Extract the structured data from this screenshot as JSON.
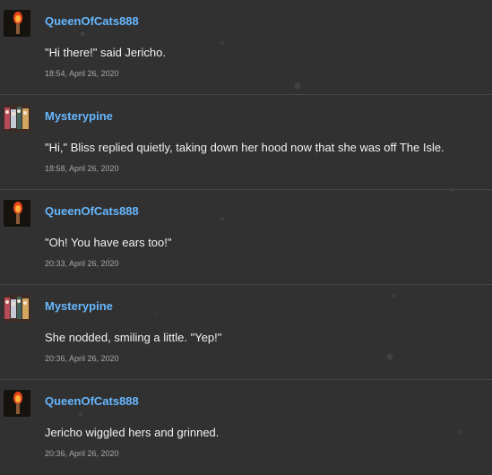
{
  "thread": {
    "posts": [
      {
        "username": "QueenOfCats888",
        "avatar_icon": "torch-flame-avatar",
        "message": "\"Hi there!\" said Jericho.",
        "timestamp": "18:54, April 26, 2020"
      },
      {
        "username": "Mysterypine",
        "avatar_icon": "colorful-group-avatar",
        "message": "\"Hi,\" Bliss replied quietly, taking down her hood now that she was off The Isle.",
        "timestamp": "18:58, April 26, 2020"
      },
      {
        "username": "QueenOfCats888",
        "avatar_icon": "torch-flame-avatar",
        "message": "\"Oh! You have ears too!\"",
        "timestamp": "20:33, April 26, 2020"
      },
      {
        "username": "Mysterypine",
        "avatar_icon": "colorful-group-avatar",
        "message": "She nodded, smiling a little. \"Yep!\"",
        "timestamp": "20:36, April 26, 2020"
      },
      {
        "username": "QueenOfCats888",
        "avatar_icon": "torch-flame-avatar",
        "message": "Jericho wiggled hers and grinned.",
        "timestamp": "20:36, April 26, 2020"
      }
    ]
  },
  "colors": {
    "background": "#313131",
    "username": "#66b7ff",
    "message_text": "#f2f2f2",
    "timestamp_text": "#a8a8a8",
    "divider": "#474747"
  }
}
